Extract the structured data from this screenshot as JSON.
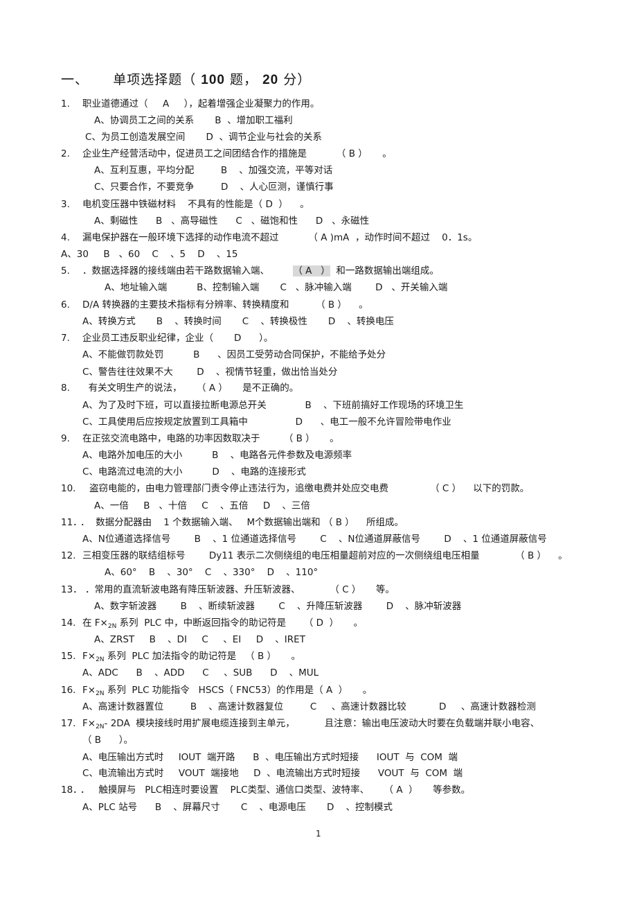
{
  "heading": {
    "prefix": "一、",
    "title_pre": "单项选择题（ ",
    "count": "100",
    "mid": " 题，",
    "score": "20",
    "post": " 分）"
  },
  "questions": [
    {
      "num": "1.",
      "stem": "职业道德通过（     A     ），起着增强企业凝聚力的作用。",
      "options": [
        "A、协调员工之间的关系       B  、增加职工福利",
        "C、为员工创造发展空间       D  、调节企业与社会的关系"
      ]
    },
    {
      "num": "2.",
      "stem": "企业生产经营活动中，促进员工之间团结合作的措施是          （ B ）     。",
      "options": [
        "A、互利互惠，平均分配         B    、加强交流，平等对话",
        "C、只要合作，不要竞争         D    、人心叵测，谨慎行事"
      ]
    },
    {
      "num": "3.",
      "stem": "电机变压器中铁磁材料    不具有的性能是（ D  ）    。",
      "options": [
        "A、剩磁性      B   、高导磁性      C   、磁饱和性      D   、永磁性"
      ]
    },
    {
      "num": "4.",
      "stem": "漏电保护器在一般环境下选择的动作电流不超过          （ A )mA  ，动作时间不超过    0．1s。",
      "options": [
        "A、30     B   、60    C    、5    D    、15"
      ]
    },
    {
      "num": "5.",
      "stem": "．数据选择器的接线端由若干路数据输入端、        ",
      "answer_highlight": "（ A   ）",
      "stem_after": "  和一路数据输出端组成。",
      "options": [
        "A、地址输入端          B、控制输入端       C   、脉冲输入端        D   、开关输入端"
      ]
    },
    {
      "num": "6.",
      "stem": "D/A 转换器的主要技术指标有分辨率、转换精度和         （ B ）    。",
      "options": [
        "A、转换方式       B    、转换时间       C    、转换极性       D    、转换电压"
      ]
    },
    {
      "num": "7.",
      "stem": "企业员工违反职业纪律，企业（       D      ）。",
      "options": [
        "A、不能做罚款处罚          B      、因员工受劳动合同保护，不能给予处分",
        "C、警告往往效果不大        D    、视情节轻重，做出恰当处分"
      ]
    },
    {
      "num": "8.",
      "stem": "  有关文明生产的说法，     （ A ）     是不正确的。",
      "options": [
        "A、为了及时下班，可以直接拉断电源总开关             B    、下班前搞好工作现场的环境卫生",
        "C、工具使用后应按规定放置到工具箱中                D      、电工一般不允许冒险带电作业"
      ]
    },
    {
      "num": "9.",
      "stem": "在正弦交流电路中，电路的功率因数取决于        （ B ）     。",
      "options": [
        "A、电路外加电压的大小          B    、电路各元件参数及电源频率",
        "C、电路流过电流的大小          D    、电路的连接形式"
      ]
    },
    {
      "num": "10.",
      "stem": "盗窃电能的，由电力管理部门责令停止违法行为，追缴电费并处应交电费              （ C ）    以下的罚款。",
      "options": [
        "A、一倍     B   、十倍     C    、五倍     D    、三倍"
      ]
    },
    {
      "num": "11．",
      "stem": "．  数据分配器由    1 个数据输入端、   M个数据输出端和 （ B ）    所组成。",
      "options": [
        "A、N位通道选择信号        B    、1 位通道选择信号        C    、N位通道屏蔽信号        D    、1 位通道屏蔽信号"
      ]
    },
    {
      "num": "12.",
      "stem": "三相变压器的联结组标号        Dy11 表示二次侧绕组的电压相量超前对应的一次侧绕组电压相量            （ B ）    。",
      "options": [
        "A、60°    B    、30°    C    、330°    D    、110°"
      ]
    },
    {
      "num": "13．",
      "stem": "．常用的直流斩波电路有降压斩波器、升压斩波器、          （ C ）     等。",
      "options": [
        "A、数字斩波器        B    、断续斩波器        C    、升降压斩波器        D    、脉冲斩波器"
      ]
    },
    {
      "num": "14.",
      "stem_pre": "在 F×",
      "sub": "2N",
      "stem": " 系列  PLC 中，中断返回指令的助记符是      （ D  ）     。",
      "options": [
        "A、ZRST     B    、DI     C     、EI     D    、IRET"
      ]
    },
    {
      "num": "15.",
      "stem_pre": "F×",
      "sub": "2N",
      "stem": " 系列  PLC 加法指令的助记符是   （ B ）     。",
      "options": [
        "A、ADC      B    、ADD      C     、SUB      D    、MUL"
      ]
    },
    {
      "num": "16.",
      "stem_pre": "F×",
      "sub": "2N",
      "stem": " 系列  PLC 功能指令   HSCS（ FNC53）的作用是（ A  ）     。",
      "options": [
        "A、高速计数器置位         B    、高速计数器复位         C     、高速计数器比较           D     、高速计数器检测"
      ]
    },
    {
      "num": "17.",
      "stem_pre": "F×",
      "sub": "2N",
      "stem": "- 2DA  模块接线时用扩展电缆连接到主单元，          且注意：输出电压波动大时要在负载端并联小电容、",
      "stem_cont": "（ B      ）。",
      "options": [
        "A、电压输出方式时     IOUT  端开路      B  、电压输出方式时短接      IOUT  与  COM  端",
        "C、电流输出方式时     VOUT  端接地     D  、电流输出方式时短接      VOUT  与  COM  端"
      ]
    },
    {
      "num": "18．",
      "stem": "．   触摸屏与   PLC相连时要设置    PLC类型、通信口类型、波特率、     （ A  ）     等参数。",
      "options": [
        "A、PLC 站号      B    、屏幕尺寸       C    、电源电压       D    、控制模式"
      ]
    }
  ],
  "page_number": "1"
}
